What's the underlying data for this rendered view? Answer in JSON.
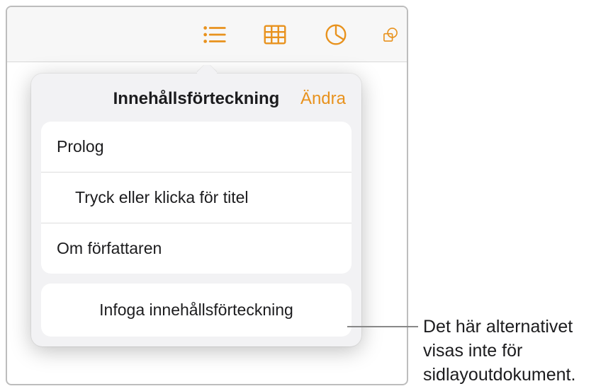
{
  "popover": {
    "title": "Innehållsförteckning",
    "edit_label": "Ändra",
    "toc_items": [
      {
        "label": "Prolog",
        "indent": false
      },
      {
        "label": "Tryck eller klicka för titel",
        "indent": true
      },
      {
        "label": "Om författaren",
        "indent": false
      }
    ],
    "insert_label": "Infoga innehållsförteckning"
  },
  "callout": {
    "text": "Det här alternativet visas inte för sidlayoutdokument."
  }
}
